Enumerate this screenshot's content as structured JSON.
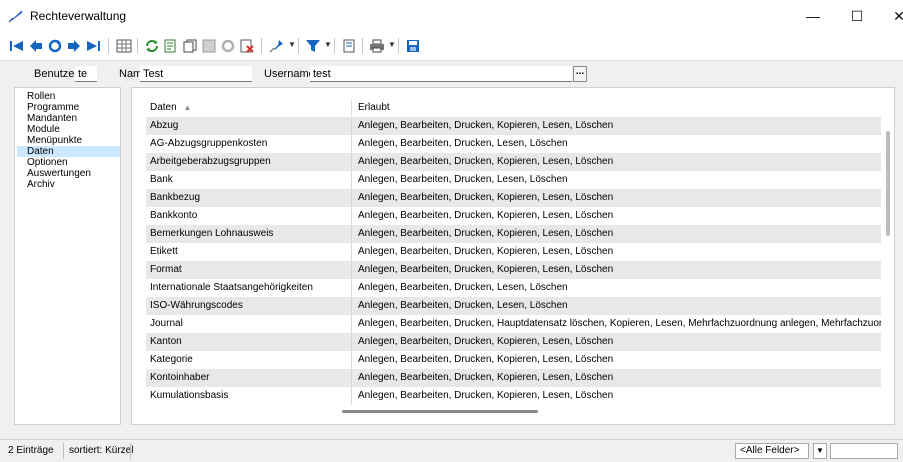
{
  "window": {
    "title": "Rechteverwaltung",
    "minimize": "—",
    "maximize": "☐",
    "close": "✕"
  },
  "toolbar": {
    "icons": [
      "first-record-icon",
      "prev-record-icon",
      "refresh-icon",
      "next-record-icon",
      "last-record-icon",
      "table-view-icon",
      "reload-icon",
      "export-icon",
      "copy-icon",
      "save-icon",
      "undo-icon",
      "delete-icon",
      "pin-icon",
      "filter-icon",
      "document-icon",
      "print-icon",
      "save-disk-icon"
    ]
  },
  "form": {
    "benutzer_label": "Benutzer",
    "benutzer_value": "te",
    "name_label": "Name",
    "name_value": "Test",
    "username_label": "Username",
    "username_value": "test",
    "more_button": "..."
  },
  "nav": {
    "items": [
      {
        "label": "Rollen"
      },
      {
        "label": "Programme"
      },
      {
        "label": "Mandanten"
      },
      {
        "label": "Module"
      },
      {
        "label": "Menüpunkte"
      },
      {
        "label": "Daten"
      },
      {
        "label": "Optionen"
      },
      {
        "label": "Auswertungen"
      },
      {
        "label": "Archiv"
      }
    ],
    "selected": "Daten"
  },
  "grid": {
    "columns": [
      "Daten",
      "Erlaubt"
    ],
    "sort_indicator": "▲",
    "rows": [
      [
        "Abzug",
        "Anlegen, Bearbeiten, Drucken, Kopieren, Lesen, Löschen"
      ],
      [
        "AG-Abzugsgruppenkosten",
        "Anlegen, Bearbeiten, Drucken, Lesen, Löschen"
      ],
      [
        "Arbeitgeberabzugsgruppen",
        "Anlegen, Bearbeiten, Drucken, Kopieren, Lesen, Löschen"
      ],
      [
        "Bank",
        "Anlegen, Bearbeiten, Drucken, Lesen, Löschen"
      ],
      [
        "Bankbezug",
        "Anlegen, Bearbeiten, Drucken, Kopieren, Lesen, Löschen"
      ],
      [
        "Bankkonto",
        "Anlegen, Bearbeiten, Drucken, Kopieren, Lesen, Löschen"
      ],
      [
        "Bemerkungen Lohnausweis",
        "Anlegen, Bearbeiten, Drucken, Kopieren, Lesen, Löschen"
      ],
      [
        "Etikett",
        "Anlegen, Bearbeiten, Drucken, Kopieren, Lesen, Löschen"
      ],
      [
        "Format",
        "Anlegen, Bearbeiten, Drucken, Kopieren, Lesen, Löschen"
      ],
      [
        "Internationale Staatsangehörigkeiten",
        "Anlegen, Bearbeiten, Drucken, Lesen, Löschen"
      ],
      [
        "ISO-Währungscodes",
        "Anlegen, Bearbeiten, Drucken, Lesen, Löschen"
      ],
      [
        "Journal",
        "Anlegen, Bearbeiten, Drucken, Hauptdatensatz löschen, Kopieren, Lesen, Mehrfachzuordnung anlegen, Mehrfachzuordnung"
      ],
      [
        "Kanton",
        "Anlegen, Bearbeiten, Drucken, Kopieren, Lesen, Löschen"
      ],
      [
        "Kategorie",
        "Anlegen, Bearbeiten, Drucken, Kopieren, Lesen, Löschen"
      ],
      [
        "Kontoinhaber",
        "Anlegen, Bearbeiten, Drucken, Kopieren, Lesen, Löschen"
      ],
      [
        "Kumulationsbasis",
        "Anlegen, Bearbeiten, Drucken, Kopieren, Lesen, Löschen"
      ]
    ]
  },
  "status": {
    "count": "2 Einträge",
    "sort": "sortiert: Kürzel",
    "filter_value": "<Alle Felder>"
  },
  "colors": {
    "selection": "#cce8ff",
    "alt_row": "#e8e8e8",
    "nav_blue": "#1565c0"
  }
}
